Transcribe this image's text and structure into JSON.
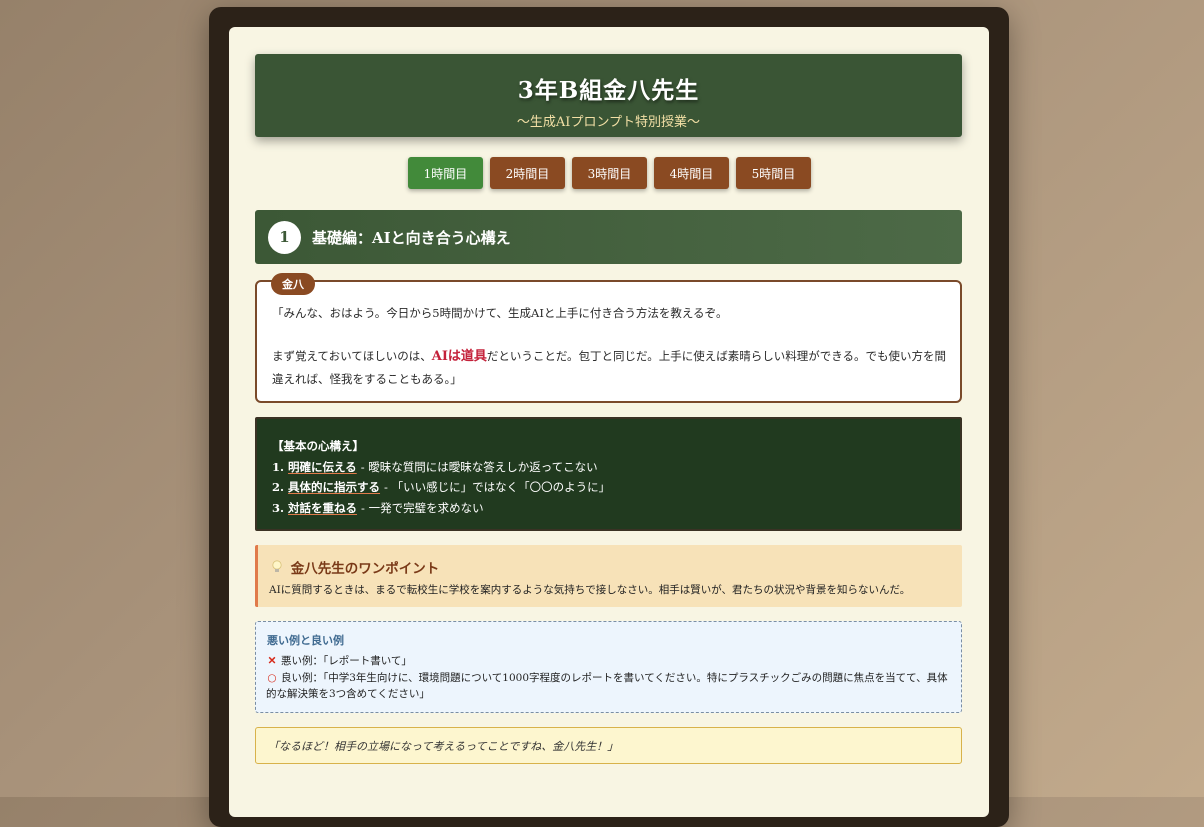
{
  "header": {
    "title": "3年B組金八先生",
    "subtitle": "〜生成AIプロンプト特別授業〜"
  },
  "tabs": [
    {
      "label": "1時間目",
      "active": true
    },
    {
      "label": "2時間目",
      "active": false
    },
    {
      "label": "3時間目",
      "active": false
    },
    {
      "label": "4時間目",
      "active": false
    },
    {
      "label": "5時間目",
      "active": false
    }
  ],
  "section": {
    "number": "1",
    "title": "基礎編：AIと向き合う心構え"
  },
  "speech": {
    "speaker": "金八",
    "line1": "「みんな、おはよう。今日から5時間かけて、生成AIと上手に付き合う方法を教えるぞ。",
    "line2_before": "まず覚えておいてほしいのは、",
    "line2_highlight": "AIは道具",
    "line2_after": "だということだ。包丁と同じだ。上手に使えば素晴らしい料理ができる。でも使い方を間違えれば、怪我をすることもある。」"
  },
  "mindset": {
    "title": "【基本の心構え】",
    "items": [
      {
        "num": "1.",
        "key": "明確に伝える",
        "desc": "- 曖昧な質問には曖昧な答えしか返ってこない"
      },
      {
        "num": "2.",
        "key": "具体的に指示する",
        "desc": "- 「いい感じに」ではなく「〇〇のように」"
      },
      {
        "num": "3.",
        "key": "対話を重ねる",
        "desc": "- 一発で完璧を求めない"
      }
    ]
  },
  "onepoint": {
    "icon": "lightbulb-icon",
    "title": "金八先生のワンポイント",
    "body": "AIに質問するときは、まるで転校生に学校を案内するような気持ちで接しなさい。相手は賢いが、君たちの状況や背景を知らないんだ。"
  },
  "examples": {
    "title": "悪い例と良い例",
    "bad_label": "悪い例：",
    "bad_text": "「レポート書いて」",
    "good_label": "良い例：",
    "good_text": "「中学3年生向けに、環境問題について1000字程度のレポートを書いてください。特にプラスチックごみの問題に焦点を当てて、具体的な解決策を3つ含めてください」"
  },
  "reply": {
    "text": "「なるほど！相手の立場になって考えるってことですね、金八先生！」"
  },
  "colors": {
    "board": "#f8f5e3",
    "chalkboard": "#213a1f",
    "header": "#3a5535",
    "tab": "#8a4a22",
    "tab_active": "#428a3a",
    "highlight": "#c4213a"
  }
}
